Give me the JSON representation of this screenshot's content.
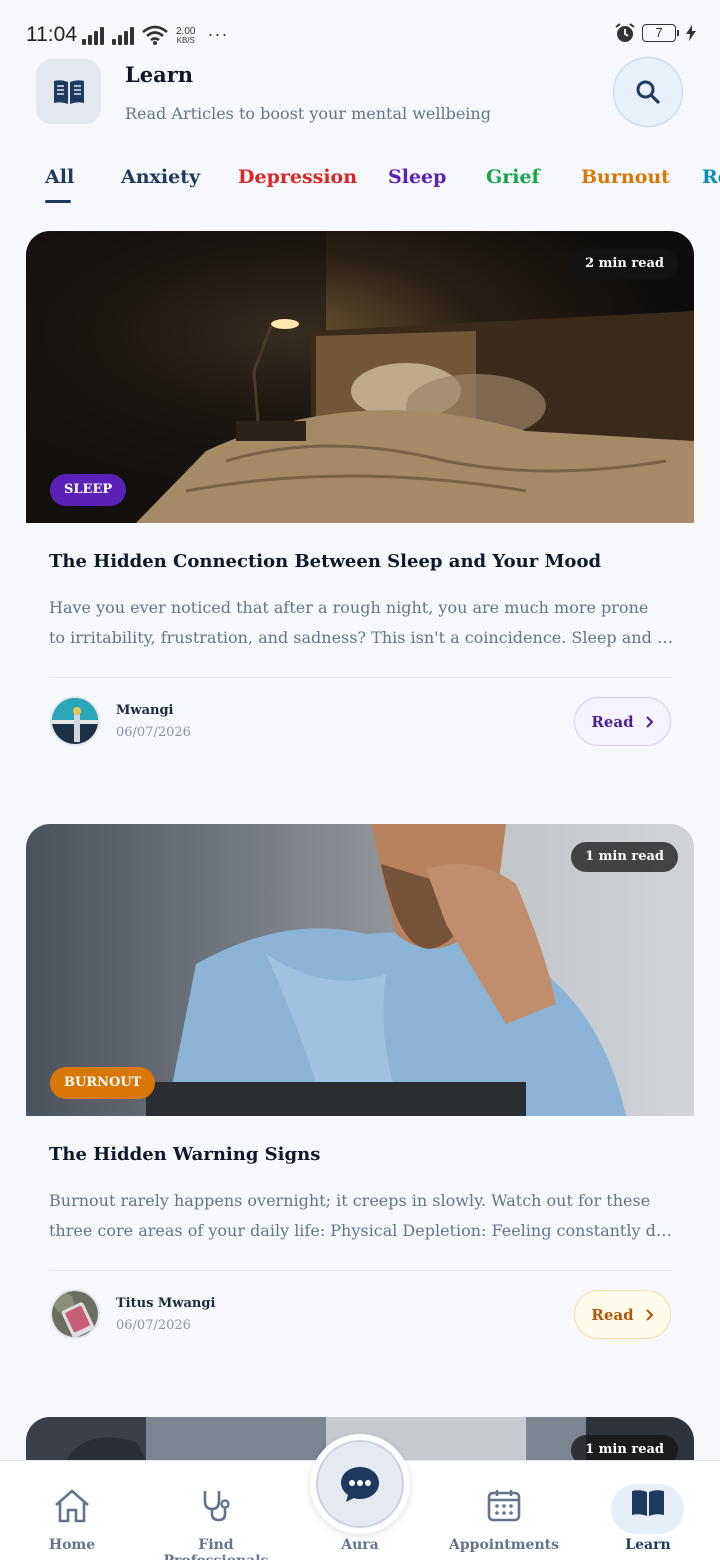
{
  "status_bar": {
    "time": "11:04",
    "net_speed_value": "2.00",
    "net_speed_unit": "KB/S",
    "more": "···",
    "battery": "7"
  },
  "header": {
    "title": "Learn",
    "subtitle": "Read Articles to boost your mental wellbeing",
    "icon": "book-open-icon",
    "search_icon": "search-icon"
  },
  "tabs": [
    {
      "label": "All",
      "color": "#1e3a5f",
      "active": true
    },
    {
      "label": "Anxiety",
      "color": "#1e3a5f"
    },
    {
      "label": "Depression",
      "color": "#dc2626"
    },
    {
      "label": "Sleep",
      "color": "#5b21b6"
    },
    {
      "label": "Grief",
      "color": "#16a34a"
    },
    {
      "label": "Burnout",
      "color": "#d97706"
    },
    {
      "label": "Re",
      "color": "#0891b2"
    }
  ],
  "articles": [
    {
      "read_time": "2 min read",
      "category": "SLEEP",
      "category_color": "#5b21b6",
      "title": "The Hidden Connection Between Sleep and Your Mood",
      "excerpt_line1": "Have you ever noticed that after a rough night, you are much more prone",
      "excerpt_line2": "to irritability, frustration, and sadness? This isn't a coincidence. Sleep and mood are deeply connected.",
      "author": "Mwangi",
      "date": "06/07/2026",
      "read_label": "Read",
      "read_color": "#4c1d95",
      "read_bg": "#f5f3ff",
      "read_border": "#d8ccf5"
    },
    {
      "read_time": "1 min read",
      "category": "BURNOUT",
      "category_color": "#d97706",
      "title": "The Hidden Warning Signs",
      "excerpt_line1": "Burnout rarely happens overnight; it creeps in slowly. Watch out for these",
      "excerpt_line2": "three core areas of your daily life: Physical Depletion: Feeling constantly drained.",
      "author": "Titus Mwangi",
      "date": "06/07/2026",
      "read_label": "Read",
      "read_color": "#b45309",
      "read_bg": "#fffbeb",
      "read_border": "#f3dba6"
    },
    {
      "read_time": "1 min read"
    }
  ],
  "nav": {
    "home": "Home",
    "find_professionals": "Find Professionals",
    "aura": "Aura",
    "appointments": "Appointments",
    "learn": "Learn"
  }
}
